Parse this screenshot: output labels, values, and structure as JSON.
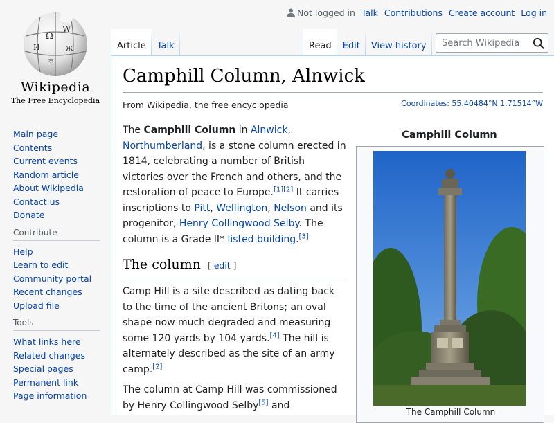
{
  "logo": {
    "wordmark": "Wikipedia",
    "tagline": "The Free Encyclopedia"
  },
  "sidebar": {
    "main": [
      {
        "label": "Main page"
      },
      {
        "label": "Contents"
      },
      {
        "label": "Current events"
      },
      {
        "label": "Random article"
      },
      {
        "label": "About Wikipedia"
      },
      {
        "label": "Contact us"
      },
      {
        "label": "Donate"
      }
    ],
    "contribute": {
      "heading": "Contribute",
      "items": [
        {
          "label": "Help"
        },
        {
          "label": "Learn to edit"
        },
        {
          "label": "Community portal"
        },
        {
          "label": "Recent changes"
        },
        {
          "label": "Upload file"
        }
      ]
    },
    "tools": {
      "heading": "Tools",
      "items": [
        {
          "label": "What links here"
        },
        {
          "label": "Related changes"
        },
        {
          "label": "Special pages"
        },
        {
          "label": "Permanent link"
        },
        {
          "label": "Page information"
        }
      ]
    }
  },
  "personal": {
    "anon": "Not logged in",
    "talk": "Talk",
    "contributions": "Contributions",
    "create_account": "Create account",
    "login": "Log in"
  },
  "tabs": {
    "article": "Article",
    "talk": "Talk",
    "read": "Read",
    "edit": "Edit",
    "history": "View history"
  },
  "search": {
    "placeholder": "Search Wikipedia"
  },
  "article": {
    "title": "Camphill Column, Alnwick",
    "site_sub": "From Wikipedia, the free encyclopedia",
    "coords_label": "Coordinates",
    "coords_value": "55.40484°N 1.71514°W",
    "intro": {
      "t1": "The ",
      "bold": "Camphill Column",
      "t2": " in ",
      "l1": "Alnwick",
      "t3": ", ",
      "l2": "Northumberland",
      "t4": ", is a stone column erected in 1814, celebrating a number of British victories over the French and others, and the restoration of peace to Europe.",
      "ref1": "[1]",
      "ref2": "[2]",
      "t5": " It carries inscriptions to ",
      "l3": "Pitt",
      "t6": ", ",
      "l4": "Wellington",
      "t7": ", ",
      "l5": "Nelson",
      "t8": " and its progenitor, ",
      "l6": "Henry Collingwood Selby",
      "t9": ". The column is a Grade II* ",
      "l7": "listed building",
      "t10": ".",
      "ref3": "[3]"
    },
    "section": {
      "heading": "The column",
      "edit_open": "[ ",
      "edit": "edit",
      "edit_close": " ]"
    },
    "p2": {
      "t1": "Camp Hill is a site described as dating back to the time of the ancient Britons; an oval shape now much degraded and measuring some 120 yards by 104 yards.",
      "ref4": "[4]",
      "t2": " The hill is alternately described as the site of an army camp.",
      "ref2": "[2]"
    },
    "p3": {
      "t1": "The column at Camp Hill was commissioned by Henry Collingwood Selby",
      "ref5": "[5]",
      "t2": " and"
    }
  },
  "infobox": {
    "title": "Camphill Column",
    "caption": "The Camphill Column"
  }
}
